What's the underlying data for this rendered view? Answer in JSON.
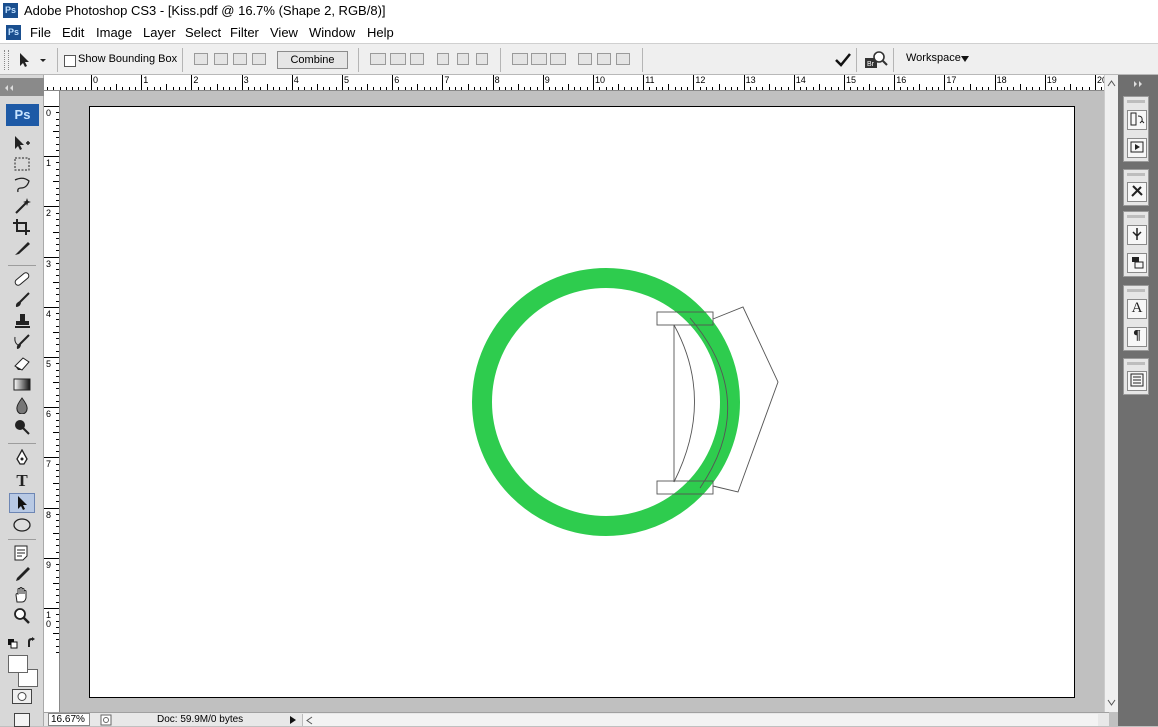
{
  "window": {
    "app_icon": "Ps",
    "title": "Adobe Photoshop CS3 - [Kiss.pdf @ 16.7% (Shape 2, RGB/8)]"
  },
  "menu": {
    "items": [
      "File",
      "Edit",
      "Image",
      "Layer",
      "Select",
      "Filter",
      "View",
      "Window",
      "Help"
    ]
  },
  "options_bar": {
    "tool_icon": "direct-selection-arrow-icon",
    "show_bounding_box_label": "Show Bounding Box",
    "show_bounding_box_checked": false,
    "combine_label": "Combine",
    "workspace_label": "Workspace"
  },
  "tools": {
    "logo": "Ps",
    "items": [
      "move",
      "marquee",
      "lasso",
      "magic-wand",
      "crop",
      "slice",
      "healing-brush",
      "brush",
      "clone-stamp",
      "history-brush",
      "eraser",
      "gradient",
      "blur",
      "dodge",
      "pen",
      "type",
      "path-selection",
      "ellipse",
      "notes",
      "eyedropper",
      "hand",
      "zoom"
    ],
    "type_tool_glyph": "T",
    "active": "path-selection"
  },
  "rulers": {
    "horizontal": [
      "0",
      "1",
      "2",
      "3",
      "4",
      "5",
      "6",
      "7",
      "8",
      "9",
      "10",
      "11",
      "12",
      "13",
      "14",
      "15",
      "16",
      "17",
      "18",
      "19",
      "20"
    ],
    "vertical": [
      "0",
      "1",
      "2",
      "3",
      "4",
      "5",
      "6",
      "7",
      "8",
      "9",
      "10"
    ]
  },
  "canvas": {
    "ring_color": "#2ecc4e",
    "document_background": "#ffffff"
  },
  "right_dock": {
    "type_glyph": "A",
    "paragraph_glyph": "¶"
  },
  "status": {
    "zoom": "16.67%",
    "doc_info": "Doc: 59.9M/0 bytes"
  },
  "colors": {
    "workspace_gray": "#c0c0c0",
    "photoshop_blue": "#1e5aa6",
    "dock_dark": "#6f6f6f"
  }
}
